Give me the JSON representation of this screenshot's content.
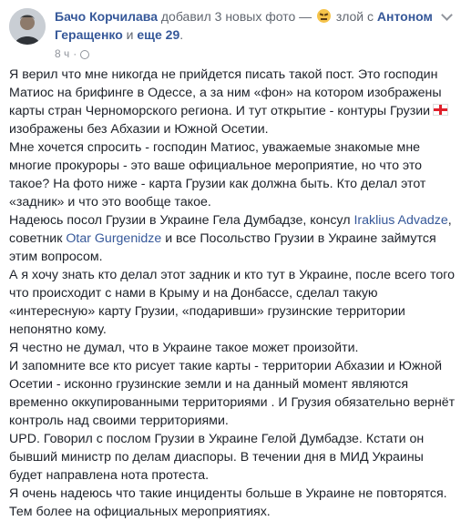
{
  "header": {
    "author": "Бачо Корчилава",
    "action_before": " добавил 3 новых фото — ",
    "feeling": " злой с ",
    "tagged_person": "Антоном",
    "tagged_person_line2": "Геращенко",
    "and_text": " и ",
    "others_link": "еще 29",
    "period": ".",
    "time": "8 ч",
    "feeling_icon": "angry-face-emoji",
    "privacy_icon": "globe-icon",
    "menu_icon": "chevron-down-icon"
  },
  "post": {
    "l1": "Я верил что мне никогда не прийдется писать такой пост. Это господин",
    "l2": "Матиос на брифинге в Одессе, а за ним «фон» на котором изображены",
    "l3": "карты стран Черноморского региона. И тут открытие - контуры Грузии",
    "l4": "изображены без Абхазии и Южной Осетии.",
    "l5": "Мне хочется спросить - господин Матиос, уважаемые знакомые мне",
    "l6": "многие прокуроры - это ваше официальное мероприятие, но что это",
    "l7": "такое? На фото ниже - карта Грузии как должна быть. Кто делал этот",
    "l8": "«задник» и что это вообще такое.",
    "l9a": "Надеюсь посол Грузии в Украине Гела Думбадзе, консул ",
    "l9link": "Iraklius Advadze",
    "l9b": ",",
    "l10a": "советник ",
    "l10link": "Otar Gurgenidze",
    "l10b": " и все Посольство Грузии в Украине займутся",
    "l11": "этим вопросом.",
    "l12": "А я хочу знать кто делал этот задник и кто тут в Украине, после всего того",
    "l13": "что происходит с нами в Крыму и на Донбассе, сделал такую",
    "l14": "«интересную» карту Грузии, «подаривши» грузинские территории",
    "l15": "непонятно кому.",
    "l16": "Я честно не думал, что в Украине такое может произойти.",
    "l17": "И запомните все кто рисует такие карты - территории Абхазии и Южной",
    "l18": "Осетии - исконно грузинские земли и на данный момент являются",
    "l19": "временно оккупированными территориями . И Грузия обязательно вернёт",
    "l20": "контроль над своими территориями.",
    "l21": "UPD. Говорил с послом Грузии в Украине Гелой Думбадзе. Кстати он",
    "l22": "бывший министр по делам диаспоры. В течении дня в МИД Украины",
    "l23": "будет направлена нота протеста.",
    "l24": "Я очень надеюсь что такие инциденты больше в Украине не повторятся.",
    "l25": "Тем более на официальных мероприятиях.",
    "flag_icon": "georgia-flag-icon"
  }
}
